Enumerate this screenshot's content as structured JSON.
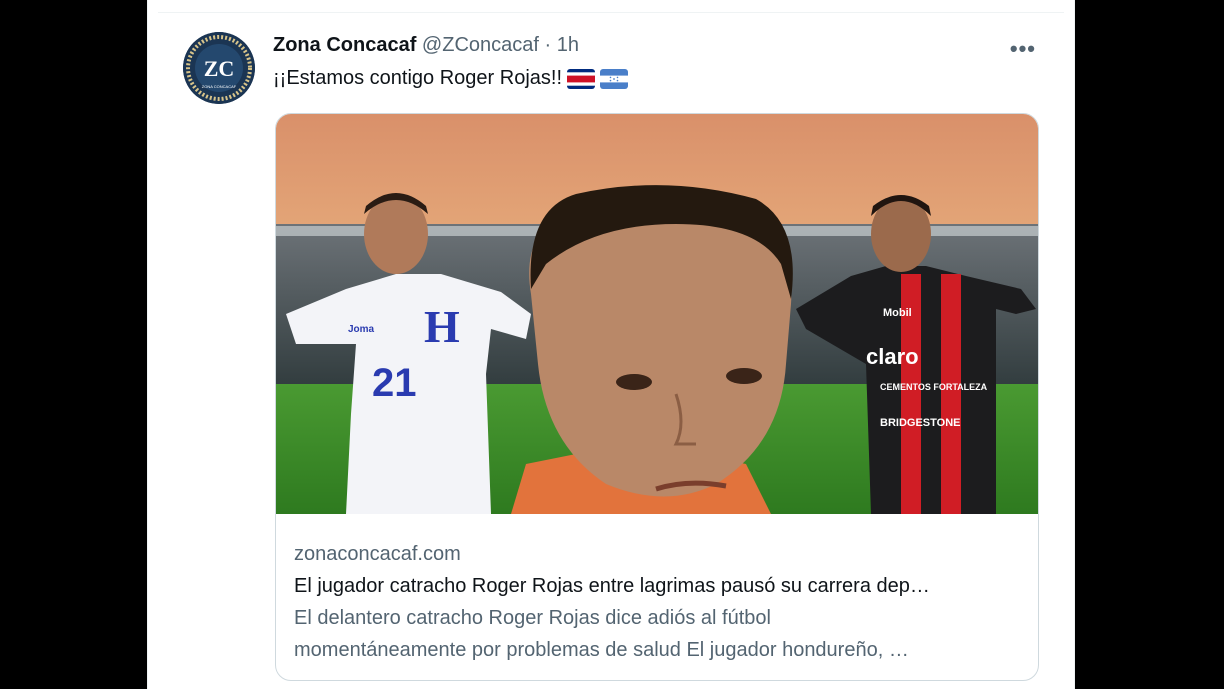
{
  "tweet": {
    "display_name": "Zona Concacaf",
    "handle": "@ZConcacaf",
    "separator": "·",
    "time": "1h",
    "text": "¡¡Estamos contigo Roger Rojas!!",
    "avatar_initials": "ZC",
    "avatar_caption": "ZONA CONCACAF",
    "more_icon": "more-icon",
    "flags": [
      "costa-rica-flag",
      "honduras-flag"
    ]
  },
  "card": {
    "image": {
      "left_jersey_number": "21",
      "left_jersey_letter": "H",
      "left_jersey_brand": "Joma",
      "right_jersey_sponsor": "claro",
      "right_jersey_sponsor_top": "Mobil",
      "right_jersey_sponsor_mid": "CEMENTOS FORTALEZA",
      "right_jersey_sponsor_bottom": "BRIDGESTONE"
    },
    "domain": "zonaconcacaf.com",
    "title": "El jugador catracho Roger Rojas entre lagrimas pausó su carrera dep…",
    "description_line1": "El delantero catracho Roger Rojas dice adiós al fútbol",
    "description_line2": "momentáneamente por problemas de salud El jugador hondureño, …"
  }
}
